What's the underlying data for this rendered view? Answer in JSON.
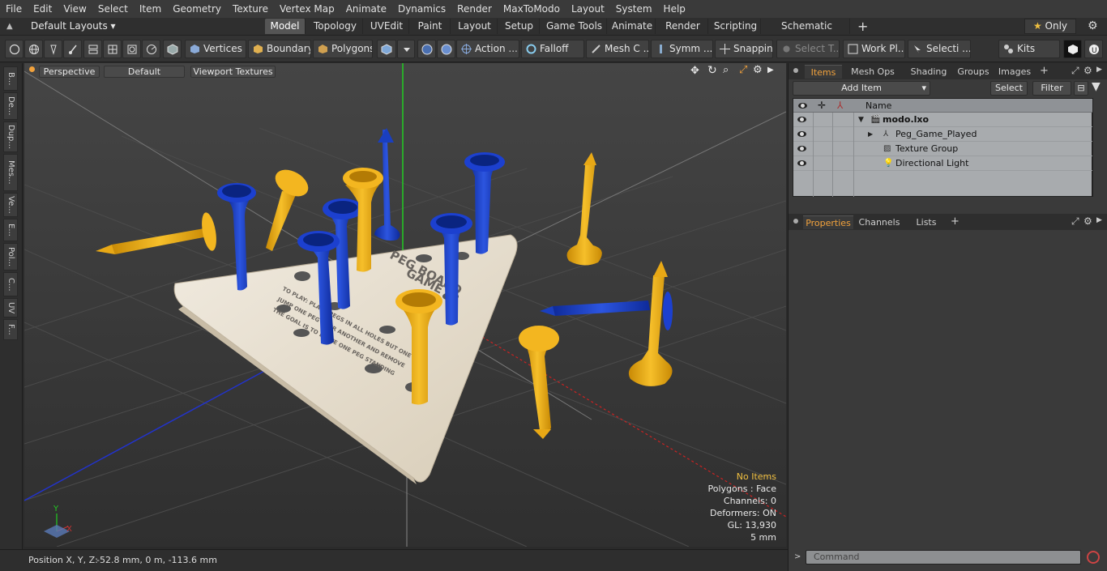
{
  "menu": [
    "File",
    "Edit",
    "View",
    "Select",
    "Item",
    "Geometry",
    "Texture",
    "Vertex Map",
    "Animate",
    "Dynamics",
    "Render",
    "MaxToModo",
    "Layout",
    "System",
    "Help"
  ],
  "layouts": {
    "selector": "Default Layouts",
    "tabs": [
      "Model",
      "Topology",
      "UVEdit",
      "Paint",
      "Layout",
      "Setup",
      "Game Tools",
      "Animate",
      "Render",
      "Scripting",
      "Schematic Fusion"
    ],
    "active_tab": "Model",
    "only_label": "Only"
  },
  "toolbar": {
    "vertices": "Vertices",
    "boundary": "Boundary",
    "polygons": "Polygons",
    "action": "Action",
    "falloff": "Falloff",
    "mesh": "Mesh C ...",
    "symm": "Symm ...",
    "snapping": "Snapping",
    "select_t": "Select T...",
    "work_pl": "Work Pl...",
    "selecti": "Selecti ...",
    "kits": "Kits"
  },
  "left_tabs": [
    "B...",
    "De...",
    "Dup...",
    "Mes...",
    "Ve...",
    "E...",
    "Pol...",
    "C...",
    "UV",
    "F..."
  ],
  "viewport": {
    "view_mode": "Perspective",
    "shading": "Default",
    "textures": "Viewport Textures",
    "info": {
      "selection": "No Items",
      "polygons": "Polygons : Face",
      "channels": "Channels: 0",
      "deformers": "Deformers: ON",
      "gl": "GL: 13,930",
      "scale": "5 mm"
    },
    "axis": {
      "x": "X",
      "y": "Y"
    }
  },
  "status": {
    "label": "Position X, Y, Z:",
    "value": "-52.8 mm, 0 m, -113.6 mm"
  },
  "items_panel": {
    "tabs": [
      "Items",
      "Mesh Ops",
      "Shading",
      "Groups",
      "Images"
    ],
    "active_tab": "Items",
    "add_item": "Add Item",
    "select": "Select",
    "filter": "Filter",
    "col_name": "Name",
    "rows": [
      {
        "name": "modo.lxo",
        "indent": 0
      },
      {
        "name": "Peg_Game_Played",
        "indent": 1
      },
      {
        "name": "Texture Group",
        "indent": 1
      },
      {
        "name": "Directional Light",
        "indent": 1
      }
    ]
  },
  "properties_panel": {
    "tabs": [
      "Properties",
      "Channels",
      "Lists"
    ],
    "active_tab": "Properties"
  },
  "command": {
    "placeholder": "Command"
  },
  "colors": {
    "accent": "#f2a23c",
    "peg_blue": "#1a3fbf",
    "peg_yellow": "#e8a815",
    "board": "#e8e0d0"
  }
}
